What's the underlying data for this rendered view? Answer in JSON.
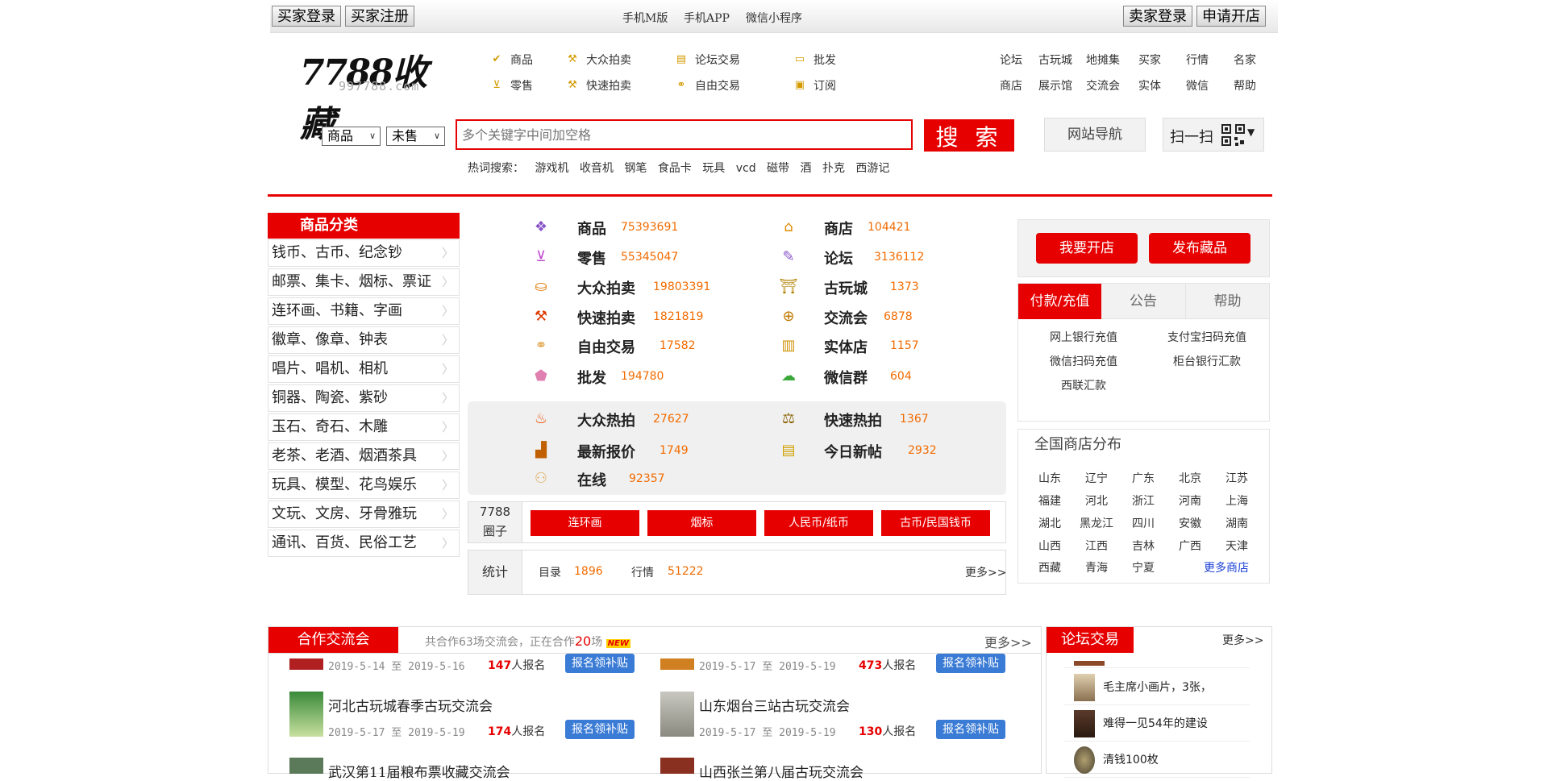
{
  "topbar": {
    "buyer_login": "买家登录",
    "buyer_register": "买家注册",
    "mobile_m": "手机M版",
    "mobile_app": "手机APP",
    "wechat_mini": "微信小程序",
    "seller_login": "卖家登录",
    "open_shop": "申请开店"
  },
  "logo": {
    "text": "7788收藏",
    "domain": "997788.com"
  },
  "header_nav": {
    "row1": [
      "商品",
      "大众拍卖",
      "论坛交易",
      "批发"
    ],
    "row2": [
      "零售",
      "快速拍卖",
      "自由交易",
      "订阅"
    ]
  },
  "right_nav": {
    "row1": [
      "论坛",
      "古玩城",
      "地摊集",
      "买家",
      "行情",
      "名家"
    ],
    "row2": [
      "商店",
      "展示馆",
      "交流会",
      "实体",
      "微信",
      "帮助"
    ]
  },
  "search": {
    "category": "商品",
    "status": "未售",
    "placeholder": "多个关键字中间加空格",
    "button": "搜 索",
    "site_nav": "网站导航",
    "scan": "扫一扫"
  },
  "hot_search": {
    "label": "热词搜索：",
    "words": [
      "游戏机",
      "收音机",
      "钢笔",
      "食品卡",
      "玩具",
      "vcd",
      "磁带",
      "酒",
      "扑克",
      "西游记"
    ]
  },
  "category": {
    "title": "商品分类",
    "items": [
      "钱币、古币、纪念钞",
      "邮票、集卡、烟标、票证",
      "连环画、书籍、字画",
      "徽章、像章、钟表",
      "唱片、唱机、相机",
      "铜器、陶瓷、紫砂",
      "玉石、奇石、木雕",
      "老茶、老酒、烟酒茶具",
      "玩具、模型、花鸟娱乐",
      "文玩、文房、牙骨雅玩",
      "通讯、百货、民俗工艺"
    ]
  },
  "stats_left": [
    {
      "name": "商品",
      "value": "75393691"
    },
    {
      "name": "零售",
      "value": "55345047"
    },
    {
      "name": "大众拍卖",
      "value": "19803391"
    },
    {
      "name": "快速拍卖",
      "value": "1821819"
    },
    {
      "name": "自由交易",
      "value": "17582"
    },
    {
      "name": "批发",
      "value": "194780"
    }
  ],
  "stats_right": [
    {
      "name": "商店",
      "value": "104421"
    },
    {
      "name": "论坛",
      "value": "3136112"
    },
    {
      "name": "古玩城",
      "value": "1373"
    },
    {
      "name": "交流会",
      "value": "6878"
    },
    {
      "name": "实体店",
      "value": "1157"
    },
    {
      "name": "微信群",
      "value": "604"
    }
  ],
  "hot_stats": [
    {
      "name": "大众热拍",
      "value": "27627"
    },
    {
      "name": "快速热拍",
      "value": "1367"
    },
    {
      "name": "最新报价",
      "value": "1749"
    },
    {
      "name": "今日新帖",
      "value": "2932"
    },
    {
      "name": "在线",
      "value": "92357"
    }
  ],
  "circle": {
    "label1": "7788",
    "label2": "圈子",
    "tags": [
      "连环画",
      "烟标",
      "人民币/纸币",
      "古币/民国钱币"
    ]
  },
  "tally": {
    "label": "统计",
    "items": [
      {
        "name": "目录",
        "value": "1896"
      },
      {
        "name": "行情",
        "value": "51222"
      }
    ],
    "more": "更多>>"
  },
  "actions": {
    "open_shop": "我要开店",
    "post_item": "发布藏品"
  },
  "pay_tabs": {
    "tabs": [
      "付款/充值",
      "公告",
      "帮助"
    ],
    "links": [
      "网上银行充值",
      "支付宝扫码充值",
      "微信扫码充值",
      "柜台银行汇款",
      "西联汇款"
    ]
  },
  "shops": {
    "title": "全国商店分布",
    "provinces": [
      "山东",
      "辽宁",
      "广东",
      "北京",
      "江苏",
      "福建",
      "河北",
      "浙江",
      "河南",
      "上海",
      "湖北",
      "黑龙江",
      "四川",
      "安徽",
      "湖南",
      "山西",
      "江西",
      "吉林",
      "广西",
      "天津",
      "西藏",
      "青海",
      "宁夏"
    ],
    "more": "更多商店"
  },
  "coop": {
    "title": "合作交流会",
    "summary_pre": "共合作63场交流会，正在合作",
    "summary_num": "20",
    "summary_post": "场",
    "new_badge": "NEW",
    "more": "更多>>",
    "events": [
      {
        "title": "",
        "start": "2019-5-14",
        "end": "2019-5-16",
        "count": "147",
        "suffix": "人报名",
        "btn": "报名领补贴",
        "sep": "至"
      },
      {
        "title": "",
        "start": "2019-5-17",
        "end": "2019-5-19",
        "count": "473",
        "suffix": "人报名",
        "btn": "报名领补贴",
        "sep": "至"
      },
      {
        "title": "河北古玩城春季古玩交流会",
        "start": "2019-5-17",
        "end": "2019-5-19",
        "count": "174",
        "suffix": "人报名",
        "btn": "报名领补贴",
        "sep": "至"
      },
      {
        "title": "山东烟台三站古玩交流会",
        "start": "2019-5-17",
        "end": "2019-5-19",
        "count": "130",
        "suffix": "人报名",
        "btn": "报名领补贴",
        "sep": "至"
      },
      {
        "title": "武汉第11届粮布票收藏交流会"
      },
      {
        "title": "山西张兰第八届古玩交流会"
      }
    ]
  },
  "forum": {
    "title": "论坛交易",
    "more": "更多>>",
    "items": [
      "毛主席小画片，3张，",
      "难得一见54年的建设",
      "清钱100枚"
    ]
  }
}
